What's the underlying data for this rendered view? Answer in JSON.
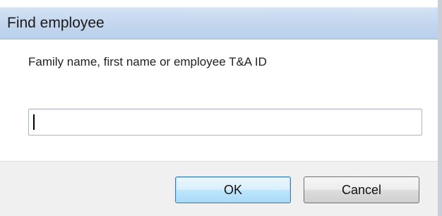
{
  "dialog": {
    "title": "Find employee",
    "prompt": "Family name, first name or employee T&A ID",
    "search_value": "",
    "ok_label": "OK",
    "cancel_label": "Cancel"
  }
}
